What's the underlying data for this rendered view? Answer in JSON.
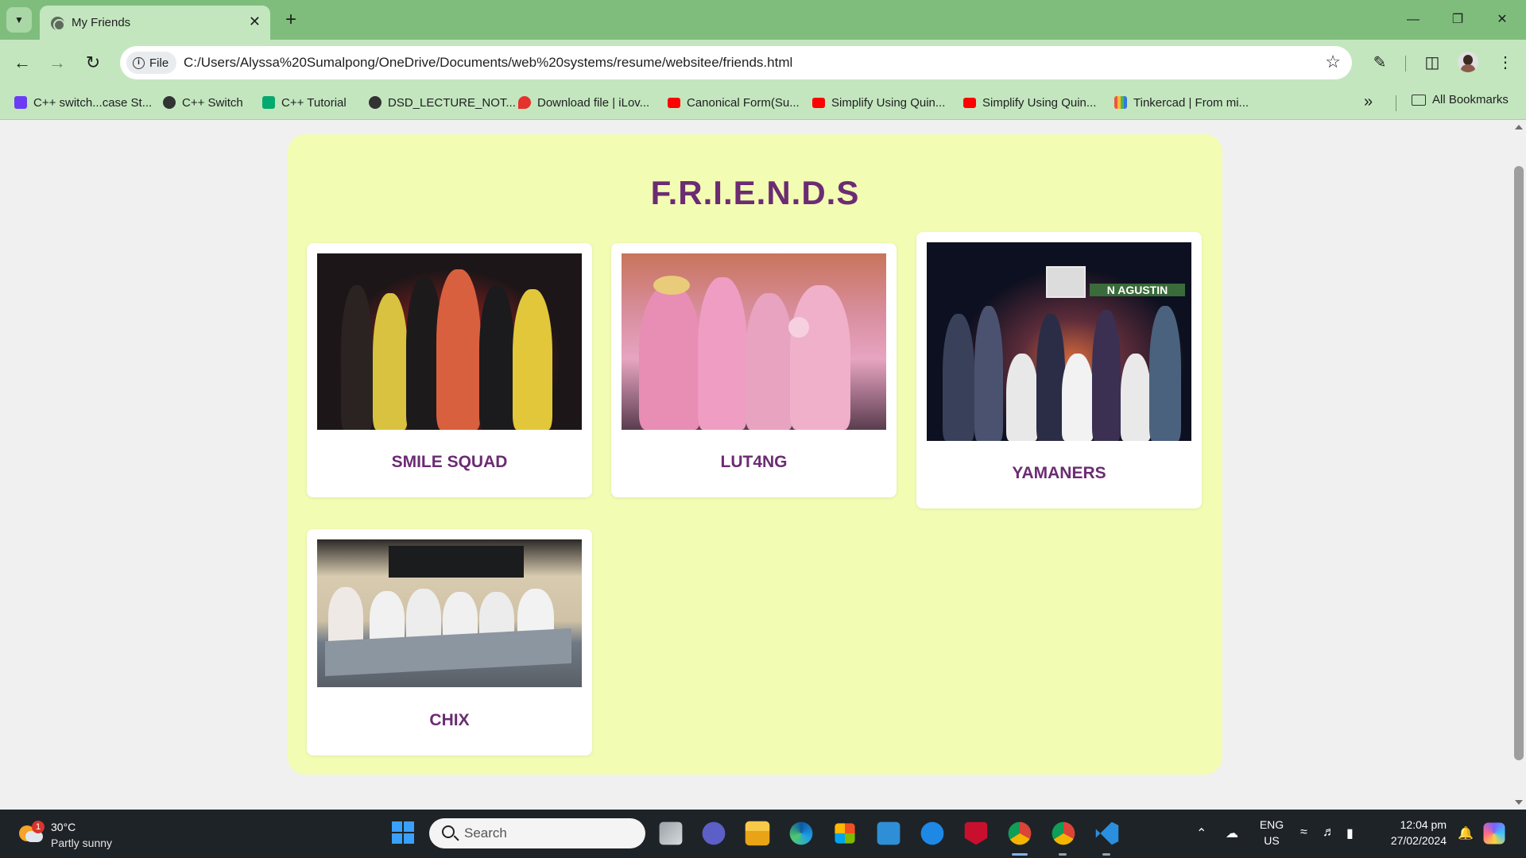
{
  "browser": {
    "tab_title": "My Friends",
    "tab_close": "✕",
    "new_tab": "+",
    "site_chip": "File",
    "url": "C:/Users/Alyssa%20Sumalpong/OneDrive/Documents/web%20systems/resume/websitee/friends.html",
    "bookmarks": [
      {
        "label": "C++ switch...case St...",
        "icon": "programiz-icon",
        "color": "#6a3df5"
      },
      {
        "label": "C++ Switch",
        "icon": "globe-icon",
        "color": "#333333"
      },
      {
        "label": "C++ Tutorial",
        "icon": "w3schools-icon",
        "color": "#04aa6d"
      },
      {
        "label": "DSD_LECTURE_NOT...",
        "icon": "globe-icon",
        "color": "#333333"
      },
      {
        "label": "Download file | iLov...",
        "icon": "ilovepdf-icon",
        "color": "#e5322d"
      },
      {
        "label": "Canonical Form(Su...",
        "icon": "youtube-icon",
        "color": "#ff0000"
      },
      {
        "label": "Simplify Using Quin...",
        "icon": "youtube-icon",
        "color": "#ff0000"
      },
      {
        "label": "Simplify Using Quin...",
        "icon": "youtube-icon",
        "color": "#ff0000"
      },
      {
        "label": "Tinkercad | From mi...",
        "icon": "tinkercad-icon",
        "color": "#1477d1"
      }
    ],
    "all_bookmarks": "All Bookmarks"
  },
  "page": {
    "title": "F.R.I.E.N.D.S",
    "cards": [
      {
        "label": "SMILE SQUAD",
        "photo": "group-photo-smile-squad"
      },
      {
        "label": "LUT4NG",
        "photo": "group-photo-lut4ng"
      },
      {
        "label": "YAMANERS",
        "photo": "group-photo-yamaners"
      },
      {
        "label": "CHIX",
        "photo": "group-photo-chix"
      }
    ]
  },
  "taskbar": {
    "temperature": "30°C",
    "weather": "Partly sunny",
    "weather_badge": "1",
    "search_placeholder": "Search",
    "language": "ENG",
    "region": "US",
    "time": "12:04 pm",
    "date": "27/02/2024"
  },
  "colors": {
    "tabbar": "#7fbd7c",
    "toolbar": "#c3e6bf",
    "container": "#f3fcb3",
    "heading": "#6b2c73",
    "taskbar": "#1e2327"
  }
}
